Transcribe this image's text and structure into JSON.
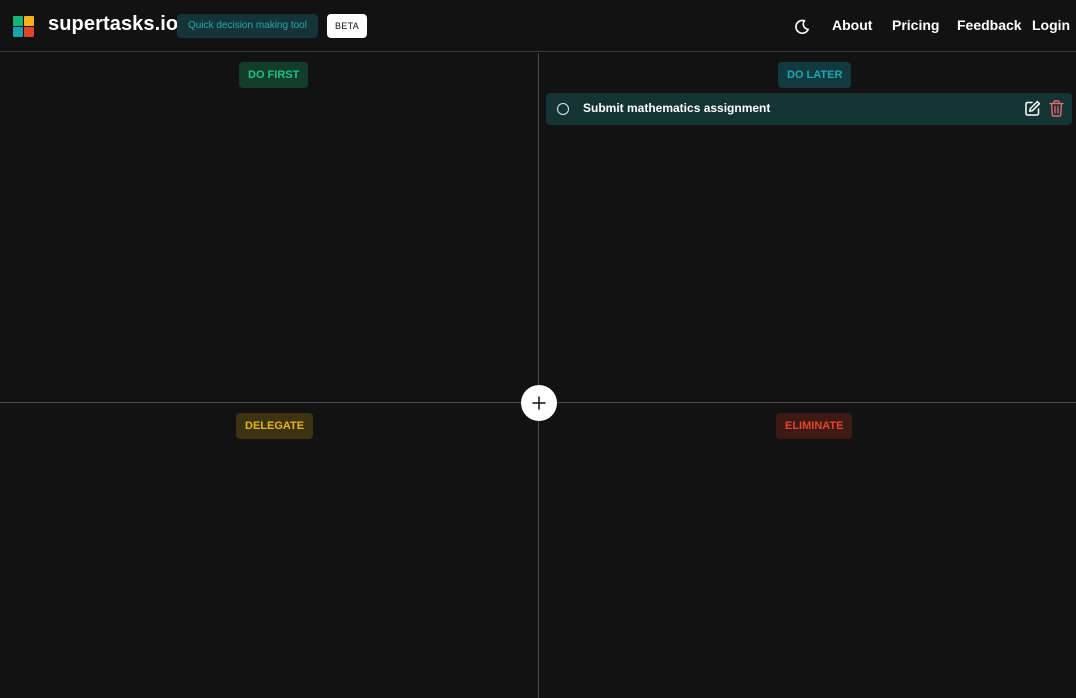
{
  "header": {
    "brand": "supertasks.io",
    "tagline": "Quick decision making tool",
    "badge": "BETA",
    "logo_colors": [
      "#15b474",
      "#f2b41a",
      "#1aa1b0",
      "#e0442a"
    ],
    "theme_icon": "moon-icon",
    "nav": {
      "about": "About",
      "pricing": "Pricing",
      "feedback": "Feedback",
      "login": "Login"
    }
  },
  "quadrants": {
    "do_first": {
      "label": "DO FIRST",
      "bg": "#123c2c",
      "fg": "#1ec27e"
    },
    "do_later": {
      "label": "DO LATER",
      "bg": "#123a3e",
      "fg": "#1aa8b6",
      "tasks": [
        {
          "title": "Submit mathematics assignment",
          "done": false
        }
      ]
    },
    "delegate": {
      "label": "DELEGATE",
      "bg": "#3c3313",
      "fg": "#e7b320"
    },
    "eliminate": {
      "label": "ELIMINATE",
      "bg": "#3d1a14",
      "fg": "#e5452a"
    }
  },
  "add_button_icon": "plus-icon",
  "task_icons": {
    "edit": "edit-icon",
    "delete": "trash-icon"
  }
}
